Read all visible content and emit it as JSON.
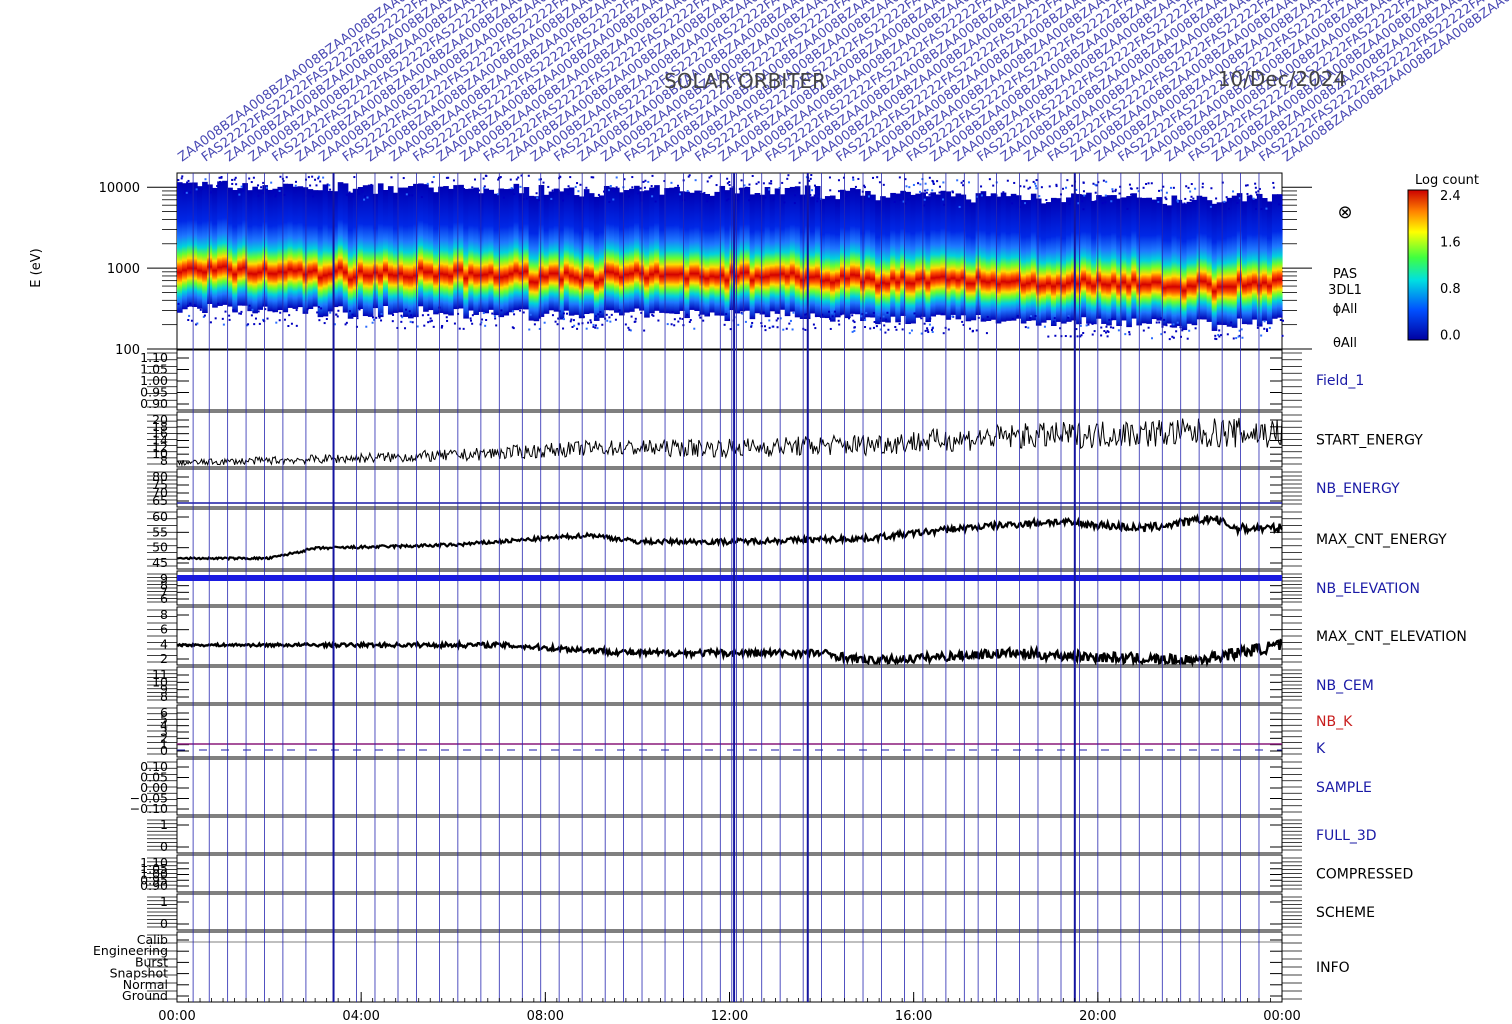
{
  "header": {
    "mission": "SOLAR  ORBITER",
    "date": "10/Dec/2024",
    "overlay_labels": [
      "ZAA008B",
      "FAS22222",
      "ZAA008B"
    ]
  },
  "colorbar": {
    "title": "Log count",
    "ticks": [
      "2.4",
      "1.6",
      "0.8",
      "0.0"
    ]
  },
  "spectrogram": {
    "ylabel": "E (eV)",
    "yticks": [
      "10000",
      "1000",
      "100"
    ],
    "right_labels": [
      "PAS",
      "3DL1",
      "ϕAll",
      "θAll"
    ],
    "symbol": "⊗"
  },
  "x_axis": {
    "ticks": [
      "00:00",
      "04:00",
      "08:00",
      "12:00",
      "16:00",
      "20:00",
      "00:00"
    ]
  },
  "panels": [
    {
      "label": "Field_1",
      "label_color": "#1a1aa6",
      "ticks": [
        "1.10",
        "1.05",
        "1.00",
        "0.95",
        "0.90"
      ]
    },
    {
      "label": "START_ENERGY",
      "label_color": "#000000",
      "ticks": [
        "20",
        "18",
        "16",
        "14",
        "12",
        "10",
        "8"
      ]
    },
    {
      "label": "NB_ENERGY",
      "label_color": "#1a1aa6",
      "ticks": [
        "80",
        "75",
        "70",
        "65"
      ]
    },
    {
      "label": "MAX_CNT_ENERGY",
      "label_color": "#000000",
      "ticks": [
        "60",
        "55",
        "50",
        "45"
      ]
    },
    {
      "label": "NB_ELEVATION",
      "label_color": "#1a1aa6",
      "ticks": [
        "9",
        "8",
        "7",
        "6"
      ]
    },
    {
      "label": "MAX_CNT_ELEVATION",
      "label_color": "#000000",
      "ticks": [
        "8",
        "6",
        "4",
        "2"
      ]
    },
    {
      "label": "NB_CEM",
      "label_color": "#1a1aa6",
      "ticks": [
        "11",
        "10",
        "9",
        "8"
      ]
    },
    {
      "label": "NB_K",
      "label_color": "#c81e1e",
      "label2": "K",
      "label2_color": "#1a1aa6",
      "ticks": [
        "6",
        "5",
        "4",
        "3",
        "2",
        "1",
        "0"
      ]
    },
    {
      "label": "SAMPLE",
      "label_color": "#1a1aa6",
      "ticks": [
        "0.10",
        "0.05",
        "0.00",
        "−0.05",
        "−0.10"
      ]
    },
    {
      "label": "FULL_3D",
      "label_color": "#1a1aa6",
      "ticks": [
        "1",
        "0"
      ]
    },
    {
      "label": "COMPRESSED",
      "label_color": "#000000",
      "ticks": [
        "1.10",
        "1.05",
        "1.00",
        "0.95",
        "0.90"
      ]
    },
    {
      "label": "SCHEME",
      "label_color": "#000000",
      "ticks": [
        "1",
        "0"
      ]
    },
    {
      "label": "INFO",
      "label_color": "#000000",
      "ticks": [
        "Calib",
        "Engineering",
        "Burst",
        "Snapshot",
        "Normal",
        "Ground"
      ]
    }
  ],
  "chart_data": [
    {
      "type": "heatmap",
      "title": "",
      "xlabel": "",
      "ylabel": "E (eV)",
      "x_range_hours": [
        0,
        24
      ],
      "y_scale": "log",
      "ylim": [
        100,
        15000
      ],
      "colorbar_range": [
        0.0,
        2.4
      ],
      "colorbar_label": "Log count",
      "peak_energy_eV": {
        "x_hours": [
          0,
          3,
          6,
          10,
          12,
          16,
          20,
          22,
          24
        ],
        "values": [
          1150,
          1050,
          1000,
          950,
          980,
          850,
          780,
          720,
          800
        ]
      }
    },
    {
      "type": "line",
      "name": "START_ENERGY",
      "x_hours": [
        0,
        3,
        6,
        9,
        12,
        15,
        18,
        21,
        24
      ],
      "values": [
        8,
        9,
        10,
        12,
        12,
        13,
        15,
        16,
        16
      ],
      "ylim": [
        8,
        20
      ]
    },
    {
      "type": "line",
      "name": "MAX_CNT_ENERGY",
      "x_hours": [
        0,
        2,
        3,
        6,
        9,
        10,
        12,
        15,
        17,
        19,
        21,
        22.5,
        23,
        24
      ],
      "values": [
        47,
        47,
        50,
        51,
        54,
        52,
        52,
        53,
        56,
        58,
        56,
        59,
        56,
        56
      ],
      "ylim": [
        45,
        60
      ]
    },
    {
      "type": "line",
      "name": "MAX_CNT_ELEVATION",
      "x_hours": [
        0,
        2.8,
        7,
        10,
        14,
        15,
        18,
        22,
        24
      ],
      "values": [
        4,
        4,
        4,
        3,
        3,
        2,
        3,
        2,
        4
      ],
      "ylim": [
        2,
        8
      ]
    },
    {
      "type": "line",
      "name": "NB_ELEVATION",
      "x_hours": [
        0,
        24
      ],
      "values": [
        9,
        9
      ]
    },
    {
      "type": "line",
      "name": "NB_ENERGY",
      "x_hours": [
        0,
        24
      ],
      "values": [
        64,
        64
      ]
    },
    {
      "type": "line",
      "name": "NB_K",
      "x_hours": [
        0,
        24
      ],
      "values": [
        1,
        1
      ]
    }
  ]
}
